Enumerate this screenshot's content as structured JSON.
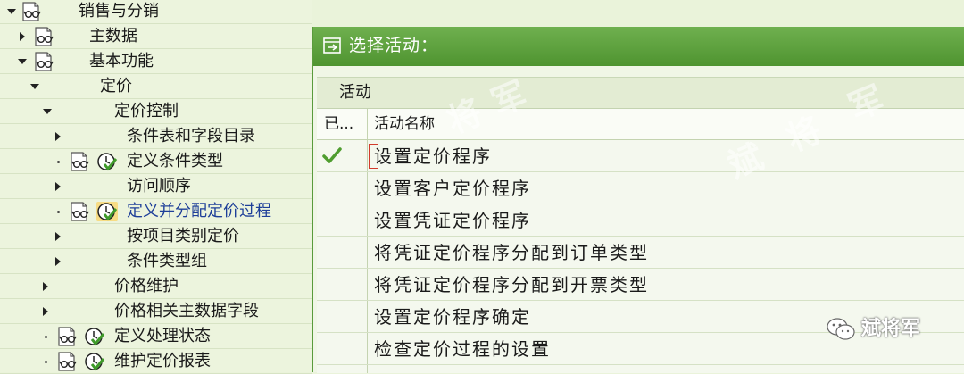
{
  "tree": {
    "items": [
      {
        "label": "销售与分销",
        "level": 0,
        "expander": "down",
        "icon": "glasses-icon"
      },
      {
        "label": "主数据",
        "level": 1,
        "expander": "right",
        "icon": "glasses-icon"
      },
      {
        "label": "基本功能",
        "level": 1,
        "expander": "down",
        "icon": "glasses-icon"
      },
      {
        "label": "定价",
        "level": 2,
        "expander": "down",
        "icon": null
      },
      {
        "label": "定价控制",
        "level": 3,
        "expander": "down",
        "icon": null
      },
      {
        "label": "条件表和字段目录",
        "level": 4,
        "expander": "right",
        "icon": null
      },
      {
        "label": "定义条件类型",
        "level": 4,
        "expander": "dot",
        "icon": "glasses-clock-icon"
      },
      {
        "label": "访问顺序",
        "level": 4,
        "expander": "right",
        "icon": null
      },
      {
        "label": "定义并分配定价过程",
        "level": 4,
        "expander": "dot",
        "icon": "glasses-clock-icon",
        "selected": true
      },
      {
        "label": "按项目类别定价",
        "level": 4,
        "expander": "right",
        "icon": null
      },
      {
        "label": "条件类型组",
        "level": 4,
        "expander": "right",
        "icon": null
      },
      {
        "label": "价格维护",
        "level": 3,
        "expander": "right",
        "icon": null
      },
      {
        "label": "价格相关主数据字段",
        "level": 3,
        "expander": "right",
        "icon": null
      },
      {
        "label": "定义处理状态",
        "level": 3,
        "expander": "dot",
        "icon": "glasses-clock-icon"
      },
      {
        "label": "维护定价报表",
        "level": 3,
        "expander": "dot",
        "icon": "glasses-clock-icon"
      }
    ]
  },
  "dialog": {
    "title": "选择活动：",
    "panel_title": "活动",
    "col_done": "已...",
    "col_name": "活动名称",
    "activities": [
      {
        "name": "设置定价程序",
        "done": true
      },
      {
        "name": "设置客户定价程序",
        "done": false
      },
      {
        "name": "设置凭证定价程序",
        "done": false
      },
      {
        "name": "将凭证定价程序分配到订单类型",
        "done": false
      },
      {
        "name": "将凭证定价程序分配到开票类型",
        "done": false
      },
      {
        "name": "设置定价程序确定",
        "done": false
      },
      {
        "name": "检查定价过程的设置",
        "done": false
      }
    ]
  },
  "watermark": {
    "text": "斌将军",
    "glyphs": [
      "斌",
      "将",
      "军"
    ]
  },
  "colors": {
    "title_bar": "#5ca13c",
    "tree_bg": "#ecf4dd",
    "selected_text": "#1e3f99",
    "check": "#4f9d2f",
    "focus": "#d23b2c"
  }
}
